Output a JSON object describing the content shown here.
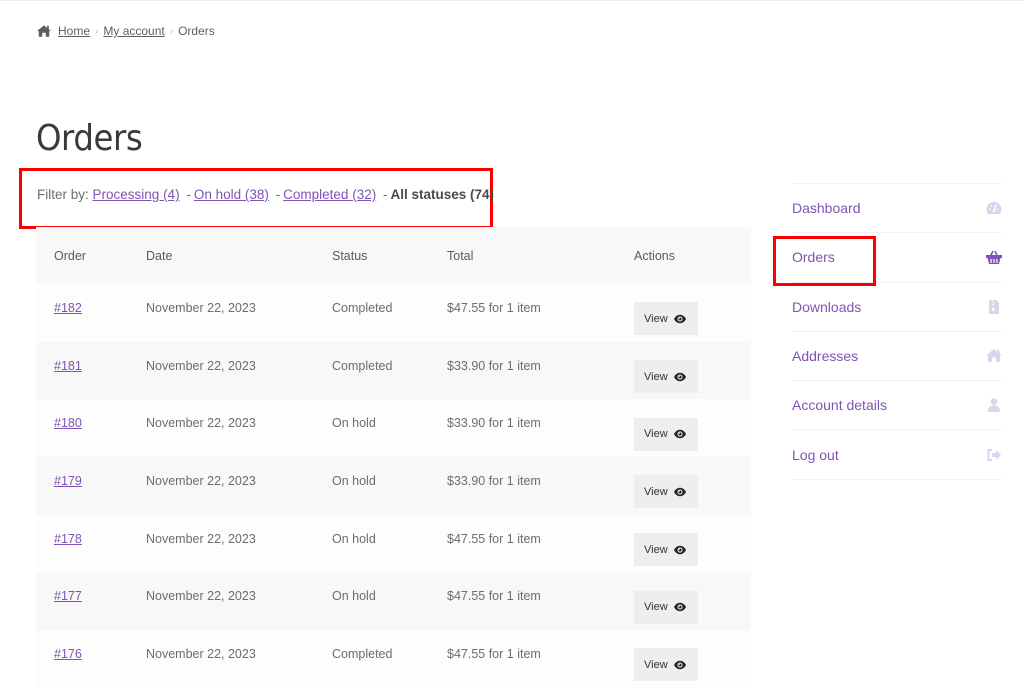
{
  "breadcrumb": {
    "icon": "home-icon",
    "items": [
      {
        "label": "Home",
        "link": true
      },
      {
        "label": "My account",
        "link": true
      },
      {
        "label": "Orders",
        "link": false
      }
    ],
    "separator": "›"
  },
  "page": {
    "title": "Orders"
  },
  "filter": {
    "prefix": "Filter by:",
    "separator": "-",
    "options": [
      {
        "label": "Processing (4)",
        "link": true
      },
      {
        "label": "On hold (38)",
        "link": true
      },
      {
        "label": "Completed (32)",
        "link": true
      },
      {
        "label": "All statuses (74)",
        "link": false,
        "current": true
      }
    ]
  },
  "table": {
    "headers": [
      "Order",
      "Date",
      "Status",
      "Total",
      "Actions"
    ],
    "rows": [
      {
        "order": "#182",
        "date": "November 22, 2023",
        "status": "Completed",
        "total": "$47.55 for 1 item",
        "action": "View"
      },
      {
        "order": "#181",
        "date": "November 22, 2023",
        "status": "Completed",
        "total": "$33.90 for 1 item",
        "action": "View"
      },
      {
        "order": "#180",
        "date": "November 22, 2023",
        "status": "On hold",
        "total": "$33.90 for 1 item",
        "action": "View"
      },
      {
        "order": "#179",
        "date": "November 22, 2023",
        "status": "On hold",
        "total": "$33.90 for 1 item",
        "action": "View"
      },
      {
        "order": "#178",
        "date": "November 22, 2023",
        "status": "On hold",
        "total": "$47.55 for 1 item",
        "action": "View"
      },
      {
        "order": "#177",
        "date": "November 22, 2023",
        "status": "On hold",
        "total": "$47.55 for 1 item",
        "action": "View"
      },
      {
        "order": "#176",
        "date": "November 22, 2023",
        "status": "Completed",
        "total": "$47.55 for 1 item",
        "action": "View"
      }
    ]
  },
  "nav": {
    "items": [
      {
        "label": "Dashboard",
        "icon": "dashboard-gauge-icon",
        "active": false
      },
      {
        "label": "Orders",
        "icon": "shopping-basket-icon",
        "active": true
      },
      {
        "label": "Downloads",
        "icon": "file-archive-icon",
        "active": false
      },
      {
        "label": "Addresses",
        "icon": "home-icon",
        "active": false
      },
      {
        "label": "Account details",
        "icon": "user-icon",
        "active": false
      },
      {
        "label": "Log out",
        "icon": "sign-out-icon",
        "active": false
      }
    ]
  },
  "colors": {
    "accent": "#7f54b3",
    "icon_inactive": "#dcd3ec",
    "highlight_box": "#ff0000",
    "row_alt": "#f8f8f8",
    "button_bg": "#eeeeee"
  }
}
